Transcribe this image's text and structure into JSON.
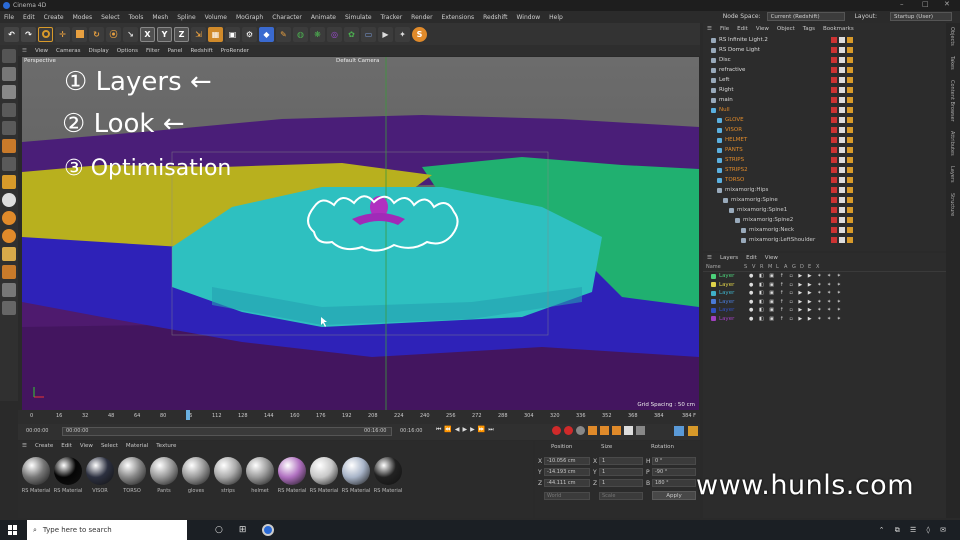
{
  "window": {
    "title": "Cinema 4D"
  },
  "menu": [
    "File",
    "Edit",
    "Create",
    "Modes",
    "Select",
    "Tools",
    "Mesh",
    "Spline",
    "Volume",
    "MoGraph",
    "Character",
    "Animate",
    "Simulate",
    "Tracker",
    "Render",
    "Extensions",
    "Redshift",
    "Window",
    "Help"
  ],
  "node_space": {
    "label": "Node Space:",
    "value": "Current (Redshift)"
  },
  "layout": {
    "label": "Layout:",
    "value": "Startup (User)"
  },
  "toolbar_axes": [
    "X",
    "Y",
    "Z"
  ],
  "viewport_menu": [
    "View",
    "Cameras",
    "Display",
    "Options",
    "Filter",
    "Panel",
    "Redshift",
    "ProRender"
  ],
  "viewport": {
    "name": "Perspective",
    "camera": "Default Camera",
    "grid_spacing": "Grid Spacing : 50 cm"
  },
  "annotations": {
    "line1": "① Layers ←",
    "line2": "② Look ←",
    "line3": "③ Optimisation"
  },
  "timeline": {
    "ticks": [
      "0",
      "16",
      "32",
      "48",
      "64",
      "80",
      "96",
      "112",
      "128",
      "144",
      "160",
      "176",
      "192",
      "208",
      "224",
      "240",
      "256",
      "272",
      "288",
      "304",
      "320",
      "336",
      "352",
      "368",
      "384"
    ],
    "current": "96 F",
    "end": "384 F"
  },
  "transport": {
    "start": "00:00:00",
    "cur": "00:00:00",
    "t1": "00:16:00",
    "t2": "00:16:00"
  },
  "mat_menu": [
    "Create",
    "Edit",
    "View",
    "Select",
    "Material",
    "Texture"
  ],
  "materials": [
    {
      "label": "RS Material",
      "color": "#777"
    },
    {
      "label": "RS Material",
      "color": "#050505"
    },
    {
      "label": "VISOR",
      "color": "#2c3040"
    },
    {
      "label": "TORSO",
      "color": "#888"
    },
    {
      "label": "Pants",
      "color": "#999"
    },
    {
      "label": "gloves",
      "color": "#9a9a9a"
    },
    {
      "label": "strips",
      "color": "#aaa"
    },
    {
      "label": "helmet",
      "color": "#9a9a9a"
    },
    {
      "label": "RS Material",
      "color": "#b070c0"
    },
    {
      "label": "RS Material",
      "color": "#c8c8c8"
    },
    {
      "label": "RS Material",
      "color": "#a8b4c8"
    },
    {
      "label": "RS Material",
      "color": "#222"
    }
  ],
  "coords": {
    "position": "Position",
    "size": "Size",
    "rotation": "Rotation",
    "x": "-10.056 cm",
    "y": "-14.193 cm",
    "z": "-44.111 cm",
    "sx": "1",
    "sy": "1",
    "sz": "1",
    "h": "0 °",
    "p": "-90 °",
    "b": "180 °",
    "mode1": "World",
    "mode2": "Scale",
    "apply": "Apply"
  },
  "obj_menu": [
    "File",
    "Edit",
    "View",
    "Object",
    "Tags",
    "Bookmarks"
  ],
  "objects": [
    {
      "name": "RS Infinite Light.2",
      "color": "#ddd",
      "indent": 0
    },
    {
      "name": "RS Dome Light",
      "color": "#ddd",
      "indent": 0
    },
    {
      "name": "Disc",
      "color": "#ddd",
      "indent": 0
    },
    {
      "name": "refractive",
      "color": "#ddd",
      "indent": 0
    },
    {
      "name": "Left",
      "color": "#ddd",
      "indent": 0
    },
    {
      "name": "Right",
      "color": "#ddd",
      "indent": 0
    },
    {
      "name": "main",
      "color": "#ddd",
      "indent": 0
    },
    {
      "name": "Null",
      "color": "#e08a2a",
      "indent": 0
    },
    {
      "name": "GLOVE",
      "color": "#e08a2a",
      "indent": 1
    },
    {
      "name": "VISOR",
      "color": "#e08a2a",
      "indent": 1
    },
    {
      "name": "HELMET",
      "color": "#e08a2a",
      "indent": 1
    },
    {
      "name": "PANTS",
      "color": "#e08a2a",
      "indent": 1
    },
    {
      "name": "STRIPS",
      "color": "#e08a2a",
      "indent": 1
    },
    {
      "name": "STRIPS2",
      "color": "#e08a2a",
      "indent": 1
    },
    {
      "name": "TORSO",
      "color": "#e08a2a",
      "indent": 1
    },
    {
      "name": "mixamorig:Hips",
      "color": "#ccc",
      "indent": 1
    },
    {
      "name": "mixamorig:Spine",
      "color": "#ccc",
      "indent": 2
    },
    {
      "name": "mixamorig:Spine1",
      "color": "#ccc",
      "indent": 3
    },
    {
      "name": "mixamorig:Spine2",
      "color": "#ccc",
      "indent": 4
    },
    {
      "name": "mixamorig:Neck",
      "color": "#ccc",
      "indent": 5
    },
    {
      "name": "mixamorig:LeftShoulder",
      "color": "#ccc",
      "indent": 5
    }
  ],
  "layer_menu": [
    "Layers",
    "Edit",
    "View"
  ],
  "layer_header": [
    "Name",
    "S",
    "V",
    "R",
    "M",
    "L",
    "A",
    "G",
    "D",
    "E",
    "X"
  ],
  "layers": [
    {
      "name": "Layer",
      "color": "#4cd07a"
    },
    {
      "name": "Layer",
      "color": "#e0d34a"
    },
    {
      "name": "Layer",
      "color": "#3fb0c8"
    },
    {
      "name": "Layer",
      "color": "#4a7bd8"
    },
    {
      "name": "Layer",
      "color": "#3050c0"
    },
    {
      "name": "Layer",
      "color": "#a040c0"
    }
  ],
  "right_tabs": [
    "Objects",
    "Takes",
    "Content Browser",
    "Attributes",
    "Layers",
    "Structure"
  ],
  "watermark": "www.hunls.com",
  "taskbar": {
    "search": "Type here to search"
  }
}
